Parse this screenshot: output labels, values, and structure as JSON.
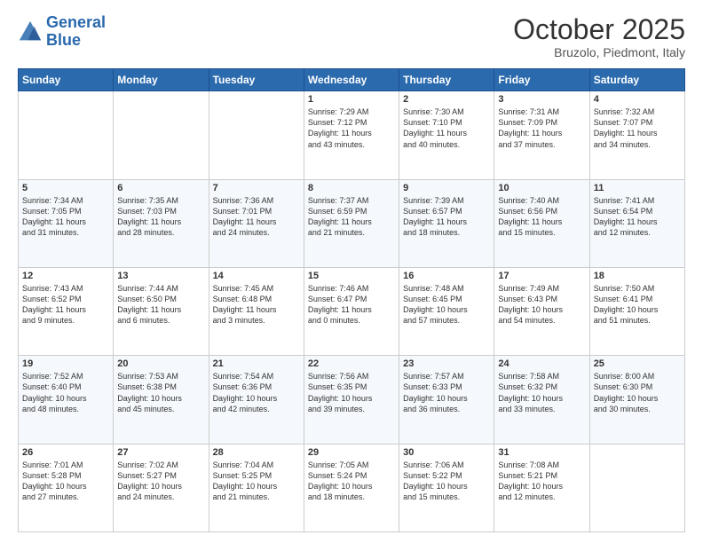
{
  "header": {
    "logo_line1": "General",
    "logo_line2": "Blue",
    "month": "October 2025",
    "location": "Bruzolo, Piedmont, Italy"
  },
  "days_of_week": [
    "Sunday",
    "Monday",
    "Tuesday",
    "Wednesday",
    "Thursday",
    "Friday",
    "Saturday"
  ],
  "weeks": [
    [
      {
        "day": "",
        "info": ""
      },
      {
        "day": "",
        "info": ""
      },
      {
        "day": "",
        "info": ""
      },
      {
        "day": "1",
        "info": "Sunrise: 7:29 AM\nSunset: 7:12 PM\nDaylight: 11 hours\nand 43 minutes."
      },
      {
        "day": "2",
        "info": "Sunrise: 7:30 AM\nSunset: 7:10 PM\nDaylight: 11 hours\nand 40 minutes."
      },
      {
        "day": "3",
        "info": "Sunrise: 7:31 AM\nSunset: 7:09 PM\nDaylight: 11 hours\nand 37 minutes."
      },
      {
        "day": "4",
        "info": "Sunrise: 7:32 AM\nSunset: 7:07 PM\nDaylight: 11 hours\nand 34 minutes."
      }
    ],
    [
      {
        "day": "5",
        "info": "Sunrise: 7:34 AM\nSunset: 7:05 PM\nDaylight: 11 hours\nand 31 minutes."
      },
      {
        "day": "6",
        "info": "Sunrise: 7:35 AM\nSunset: 7:03 PM\nDaylight: 11 hours\nand 28 minutes."
      },
      {
        "day": "7",
        "info": "Sunrise: 7:36 AM\nSunset: 7:01 PM\nDaylight: 11 hours\nand 24 minutes."
      },
      {
        "day": "8",
        "info": "Sunrise: 7:37 AM\nSunset: 6:59 PM\nDaylight: 11 hours\nand 21 minutes."
      },
      {
        "day": "9",
        "info": "Sunrise: 7:39 AM\nSunset: 6:57 PM\nDaylight: 11 hours\nand 18 minutes."
      },
      {
        "day": "10",
        "info": "Sunrise: 7:40 AM\nSunset: 6:56 PM\nDaylight: 11 hours\nand 15 minutes."
      },
      {
        "day": "11",
        "info": "Sunrise: 7:41 AM\nSunset: 6:54 PM\nDaylight: 11 hours\nand 12 minutes."
      }
    ],
    [
      {
        "day": "12",
        "info": "Sunrise: 7:43 AM\nSunset: 6:52 PM\nDaylight: 11 hours\nand 9 minutes."
      },
      {
        "day": "13",
        "info": "Sunrise: 7:44 AM\nSunset: 6:50 PM\nDaylight: 11 hours\nand 6 minutes."
      },
      {
        "day": "14",
        "info": "Sunrise: 7:45 AM\nSunset: 6:48 PM\nDaylight: 11 hours\nand 3 minutes."
      },
      {
        "day": "15",
        "info": "Sunrise: 7:46 AM\nSunset: 6:47 PM\nDaylight: 11 hours\nand 0 minutes."
      },
      {
        "day": "16",
        "info": "Sunrise: 7:48 AM\nSunset: 6:45 PM\nDaylight: 10 hours\nand 57 minutes."
      },
      {
        "day": "17",
        "info": "Sunrise: 7:49 AM\nSunset: 6:43 PM\nDaylight: 10 hours\nand 54 minutes."
      },
      {
        "day": "18",
        "info": "Sunrise: 7:50 AM\nSunset: 6:41 PM\nDaylight: 10 hours\nand 51 minutes."
      }
    ],
    [
      {
        "day": "19",
        "info": "Sunrise: 7:52 AM\nSunset: 6:40 PM\nDaylight: 10 hours\nand 48 minutes."
      },
      {
        "day": "20",
        "info": "Sunrise: 7:53 AM\nSunset: 6:38 PM\nDaylight: 10 hours\nand 45 minutes."
      },
      {
        "day": "21",
        "info": "Sunrise: 7:54 AM\nSunset: 6:36 PM\nDaylight: 10 hours\nand 42 minutes."
      },
      {
        "day": "22",
        "info": "Sunrise: 7:56 AM\nSunset: 6:35 PM\nDaylight: 10 hours\nand 39 minutes."
      },
      {
        "day": "23",
        "info": "Sunrise: 7:57 AM\nSunset: 6:33 PM\nDaylight: 10 hours\nand 36 minutes."
      },
      {
        "day": "24",
        "info": "Sunrise: 7:58 AM\nSunset: 6:32 PM\nDaylight: 10 hours\nand 33 minutes."
      },
      {
        "day": "25",
        "info": "Sunrise: 8:00 AM\nSunset: 6:30 PM\nDaylight: 10 hours\nand 30 minutes."
      }
    ],
    [
      {
        "day": "26",
        "info": "Sunrise: 7:01 AM\nSunset: 5:28 PM\nDaylight: 10 hours\nand 27 minutes."
      },
      {
        "day": "27",
        "info": "Sunrise: 7:02 AM\nSunset: 5:27 PM\nDaylight: 10 hours\nand 24 minutes."
      },
      {
        "day": "28",
        "info": "Sunrise: 7:04 AM\nSunset: 5:25 PM\nDaylight: 10 hours\nand 21 minutes."
      },
      {
        "day": "29",
        "info": "Sunrise: 7:05 AM\nSunset: 5:24 PM\nDaylight: 10 hours\nand 18 minutes."
      },
      {
        "day": "30",
        "info": "Sunrise: 7:06 AM\nSunset: 5:22 PM\nDaylight: 10 hours\nand 15 minutes."
      },
      {
        "day": "31",
        "info": "Sunrise: 7:08 AM\nSunset: 5:21 PM\nDaylight: 10 hours\nand 12 minutes."
      },
      {
        "day": "",
        "info": ""
      }
    ]
  ]
}
